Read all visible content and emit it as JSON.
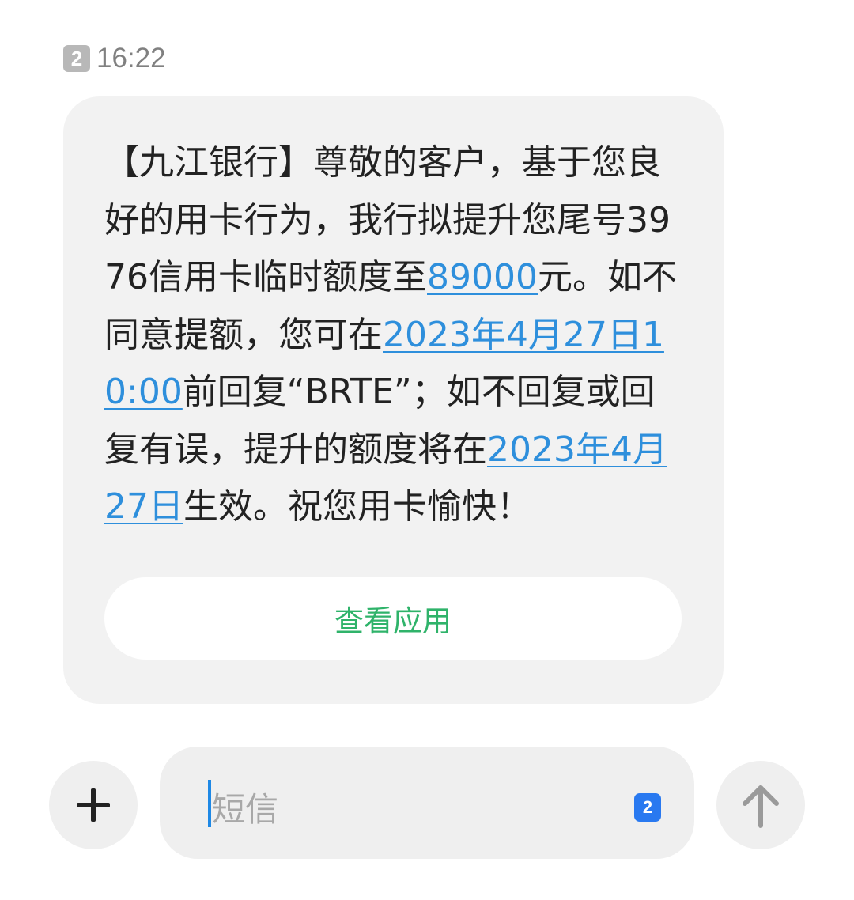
{
  "header": {
    "sim_slot": "2",
    "time": "16:22"
  },
  "message": {
    "part1": "【九江银行】尊敬的客户，基于您良好的用卡行为，我行拟提升您尾号3976信用卡临时额度至",
    "amount": "89000",
    "part2": "元。如不同意提额，您可在",
    "deadline": "2023年4月27日10:00",
    "part3": "前回复“BRTE”；如不回复或回复有误，提升的额度将在",
    "effective_date": "2023年4月27日",
    "part4": "生效。祝您用卡愉快！"
  },
  "actions": {
    "view_app_label": "查看应用"
  },
  "composer": {
    "placeholder": "短信",
    "sim_selected": "2"
  },
  "colors": {
    "link": "#2e8fdc",
    "view_app_text": "#2fb36a",
    "sim_select_bg": "#2979f0",
    "bubble_bg": "#f2f2f2"
  },
  "icons": {
    "add": "plus-icon",
    "send": "arrow-up-icon"
  }
}
